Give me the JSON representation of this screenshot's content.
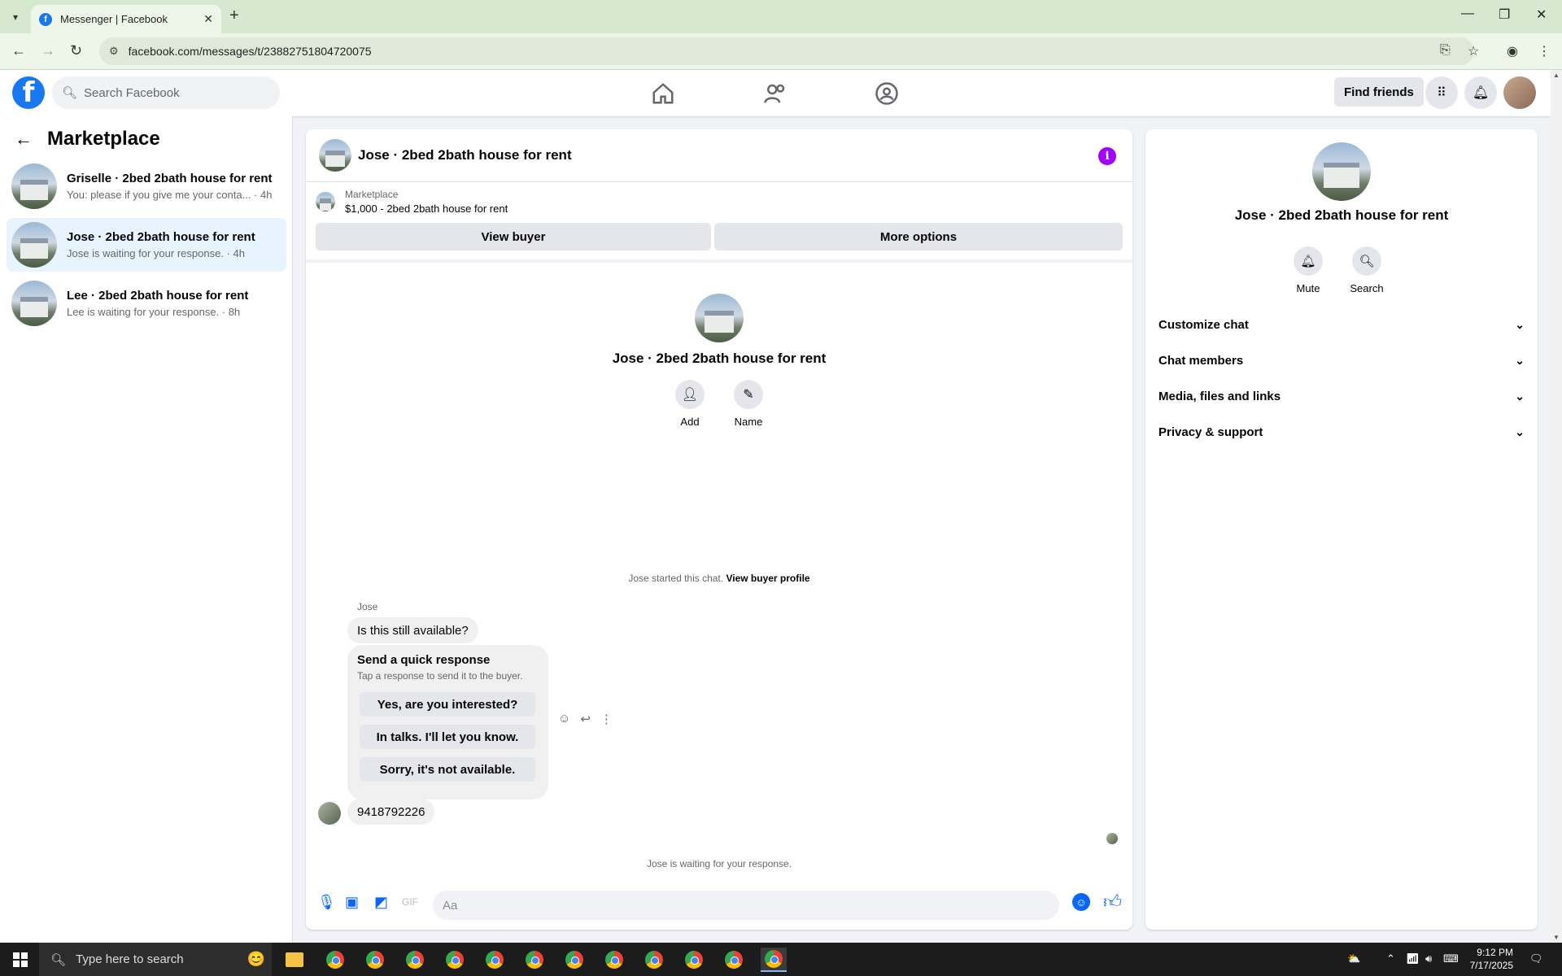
{
  "browser": {
    "tab_title": "Messenger | Facebook",
    "url": "facebook.com/messages/t/23882751804720075"
  },
  "header": {
    "search_placeholder": "Search Facebook",
    "find_friends": "Find friends"
  },
  "sidebar": {
    "title": "Marketplace",
    "conversations": [
      {
        "name": "Griselle · 2bed 2bath house for rent",
        "preview": "You: please if you give me your conta... · 4h"
      },
      {
        "name": "Jose · 2bed 2bath house for rent",
        "preview": "Jose is waiting for your response. · 4h"
      },
      {
        "name": "Lee · 2bed 2bath house for rent",
        "preview": "Lee is waiting for your response. · 8h"
      }
    ]
  },
  "chat": {
    "title": "Jose · 2bed 2bath house for rent",
    "listing_label": "Marketplace",
    "listing_detail": "$1,000 - 2bed 2bath house for rent",
    "view_buyer": "View buyer",
    "more_options": "More options",
    "profile_name": "Jose · 2bed 2bath house for rent",
    "add_label": "Add",
    "name_label": "Name",
    "started_text": "Jose started this chat.",
    "view_buyer_profile": "View buyer profile",
    "sender": "Jose",
    "message1": "Is this still available?",
    "quick_title": "Send a quick response",
    "quick_sub": "Tap a response to send it to the buyer.",
    "quick_options": [
      "Yes, are you interested?",
      "In talks. I'll let you know.",
      "Sorry, it's not available."
    ],
    "message2": "9418792226",
    "waiting": "Jose is waiting for your response.",
    "composer_placeholder": "Aa"
  },
  "right_panel": {
    "name": "Jose · 2bed 2bath house for rent",
    "mute": "Mute",
    "search": "Search",
    "rows": [
      "Customize chat",
      "Chat members",
      "Media, files and links",
      "Privacy & support"
    ]
  },
  "taskbar": {
    "search_placeholder": "Type here to search",
    "time": "9:12 PM",
    "date": "7/17/2025"
  },
  "colors": {
    "brand": "#1877f2",
    "accent": "#0866ff",
    "info": "#a100ff"
  }
}
